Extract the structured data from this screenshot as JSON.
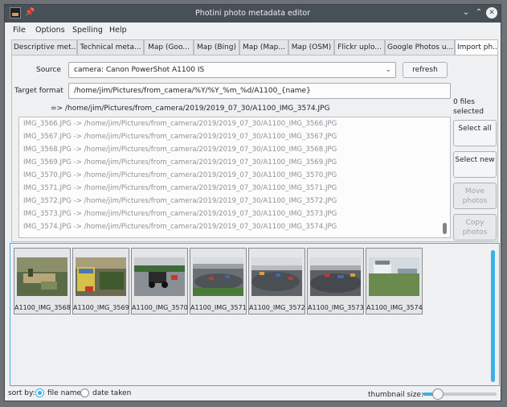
{
  "window": {
    "title": "Photini photo metadata editor"
  },
  "menu": [
    "File",
    "Options",
    "Spelling",
    "Help"
  ],
  "tabs": [
    "Descriptive met...",
    "Technical meta...",
    "Map (Goo...",
    "Map (Bing)",
    "Map (Map...",
    "Map (OSM)",
    "Flickr uplo...",
    "Google Photos u...",
    "Import ph..."
  ],
  "import": {
    "source_label": "Source",
    "source_value": "camera: Canon PowerShot A1100 IS",
    "refresh_label": "refresh",
    "target_label": "Target format",
    "target_value": "/home/jim/Pictures/from_camera/%Y/%Y_%m_%d/A1100_{name}",
    "preview_arrow": "=>",
    "preview_path": "/home/jim/Pictures/from_camera/2019/2019_07_30/A1100_IMG_3574.JPG",
    "files_selected": "0 files selected",
    "select_all_label": "Select all",
    "select_new_label": "Select new",
    "move_photos_label": "Move photos",
    "copy_photos_label": "Copy photos",
    "file_list": [
      "IMG_3566.JPG -> /home/jim/Pictures/from_camera/2019/2019_07_30/A1100_IMG_3566.JPG",
      "IMG_3567.JPG -> /home/jim/Pictures/from_camera/2019/2019_07_30/A1100_IMG_3567.JPG",
      "IMG_3568.JPG -> /home/jim/Pictures/from_camera/2019/2019_07_30/A1100_IMG_3568.JPG",
      "IMG_3569.JPG -> /home/jim/Pictures/from_camera/2019/2019_07_30/A1100_IMG_3569.JPG",
      "IMG_3570.JPG -> /home/jim/Pictures/from_camera/2019/2019_07_30/A1100_IMG_3570.JPG",
      "IMG_3571.JPG -> /home/jim/Pictures/from_camera/2019/2019_07_30/A1100_IMG_3571.JPG",
      "IMG_3572.JPG -> /home/jim/Pictures/from_camera/2019/2019_07_30/A1100_IMG_3572.JPG",
      "IMG_3573.JPG -> /home/jim/Pictures/from_camera/2019/2019_07_30/A1100_IMG_3573.JPG",
      "IMG_3574.JPG -> /home/jim/Pictures/from_camera/2019/2019_07_30/A1100_IMG_3574.JPG"
    ]
  },
  "thumbnails": [
    "A1100_IMG_3568",
    "A1100_IMG_3569",
    "A1100_IMG_3570",
    "A1100_IMG_3571",
    "A1100_IMG_3572",
    "A1100_IMG_3573",
    "A1100_IMG_3574"
  ],
  "bottom": {
    "sort_label": "sort by:",
    "sort_file_name": "file name",
    "sort_date_taken": "date taken",
    "thumb_size_label": "thumbnail size:",
    "thumb_size_value": 0.15
  },
  "colors": {
    "accent": "#3daee9",
    "titlebar": "#475057"
  },
  "icons": {
    "app": "photini-icon",
    "pin": "pin-icon",
    "minimize": "chevron-down-icon",
    "maximize": "chevron-up-icon",
    "close": "close-icon"
  }
}
